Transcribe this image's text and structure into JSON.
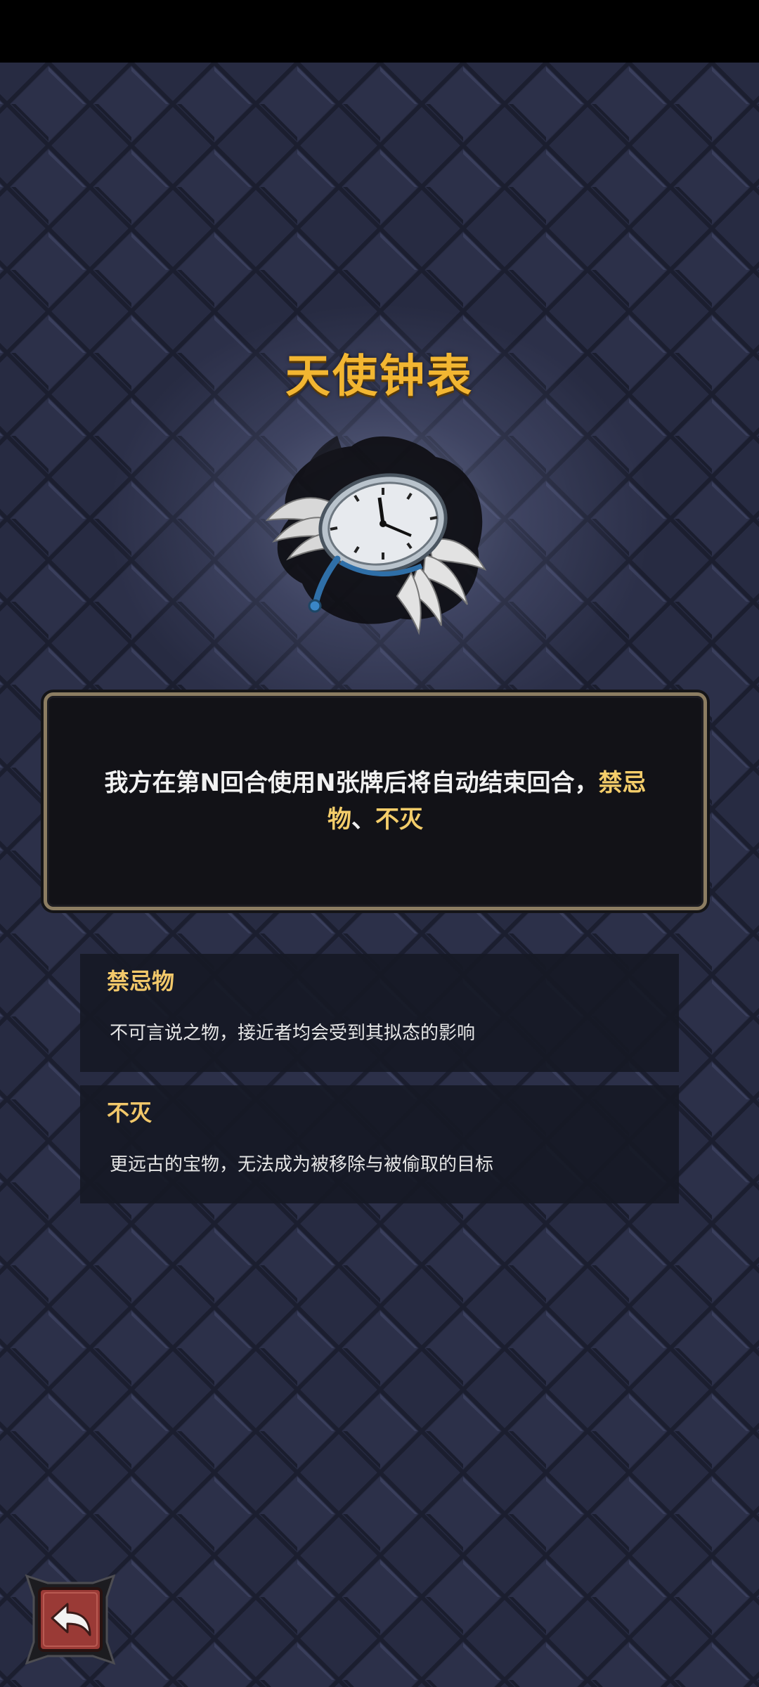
{
  "item": {
    "name": "天使钟表",
    "image_icon": "winged-pocket-watch-icon",
    "description_plain": "我方在第N回合使用N张牌后将自动结束回合，",
    "description_kw1": "禁忌物",
    "description_sep": "、",
    "description_kw2": "不灭"
  },
  "keywords": [
    {
      "name": "禁忌物",
      "desc": "不可言说之物，接近者均会受到其拟态的影响"
    },
    {
      "name": "不灭",
      "desc": "更远古的宝物，无法成为被移除与被偷取的目标"
    }
  ],
  "nav": {
    "back_icon": "return-arrow-icon"
  },
  "colors": {
    "title": "#f2b632",
    "keyword": "#f4cd6a",
    "background": "#262a41",
    "panel_border": "#8c7d62",
    "back_button": "#9a3a36"
  }
}
